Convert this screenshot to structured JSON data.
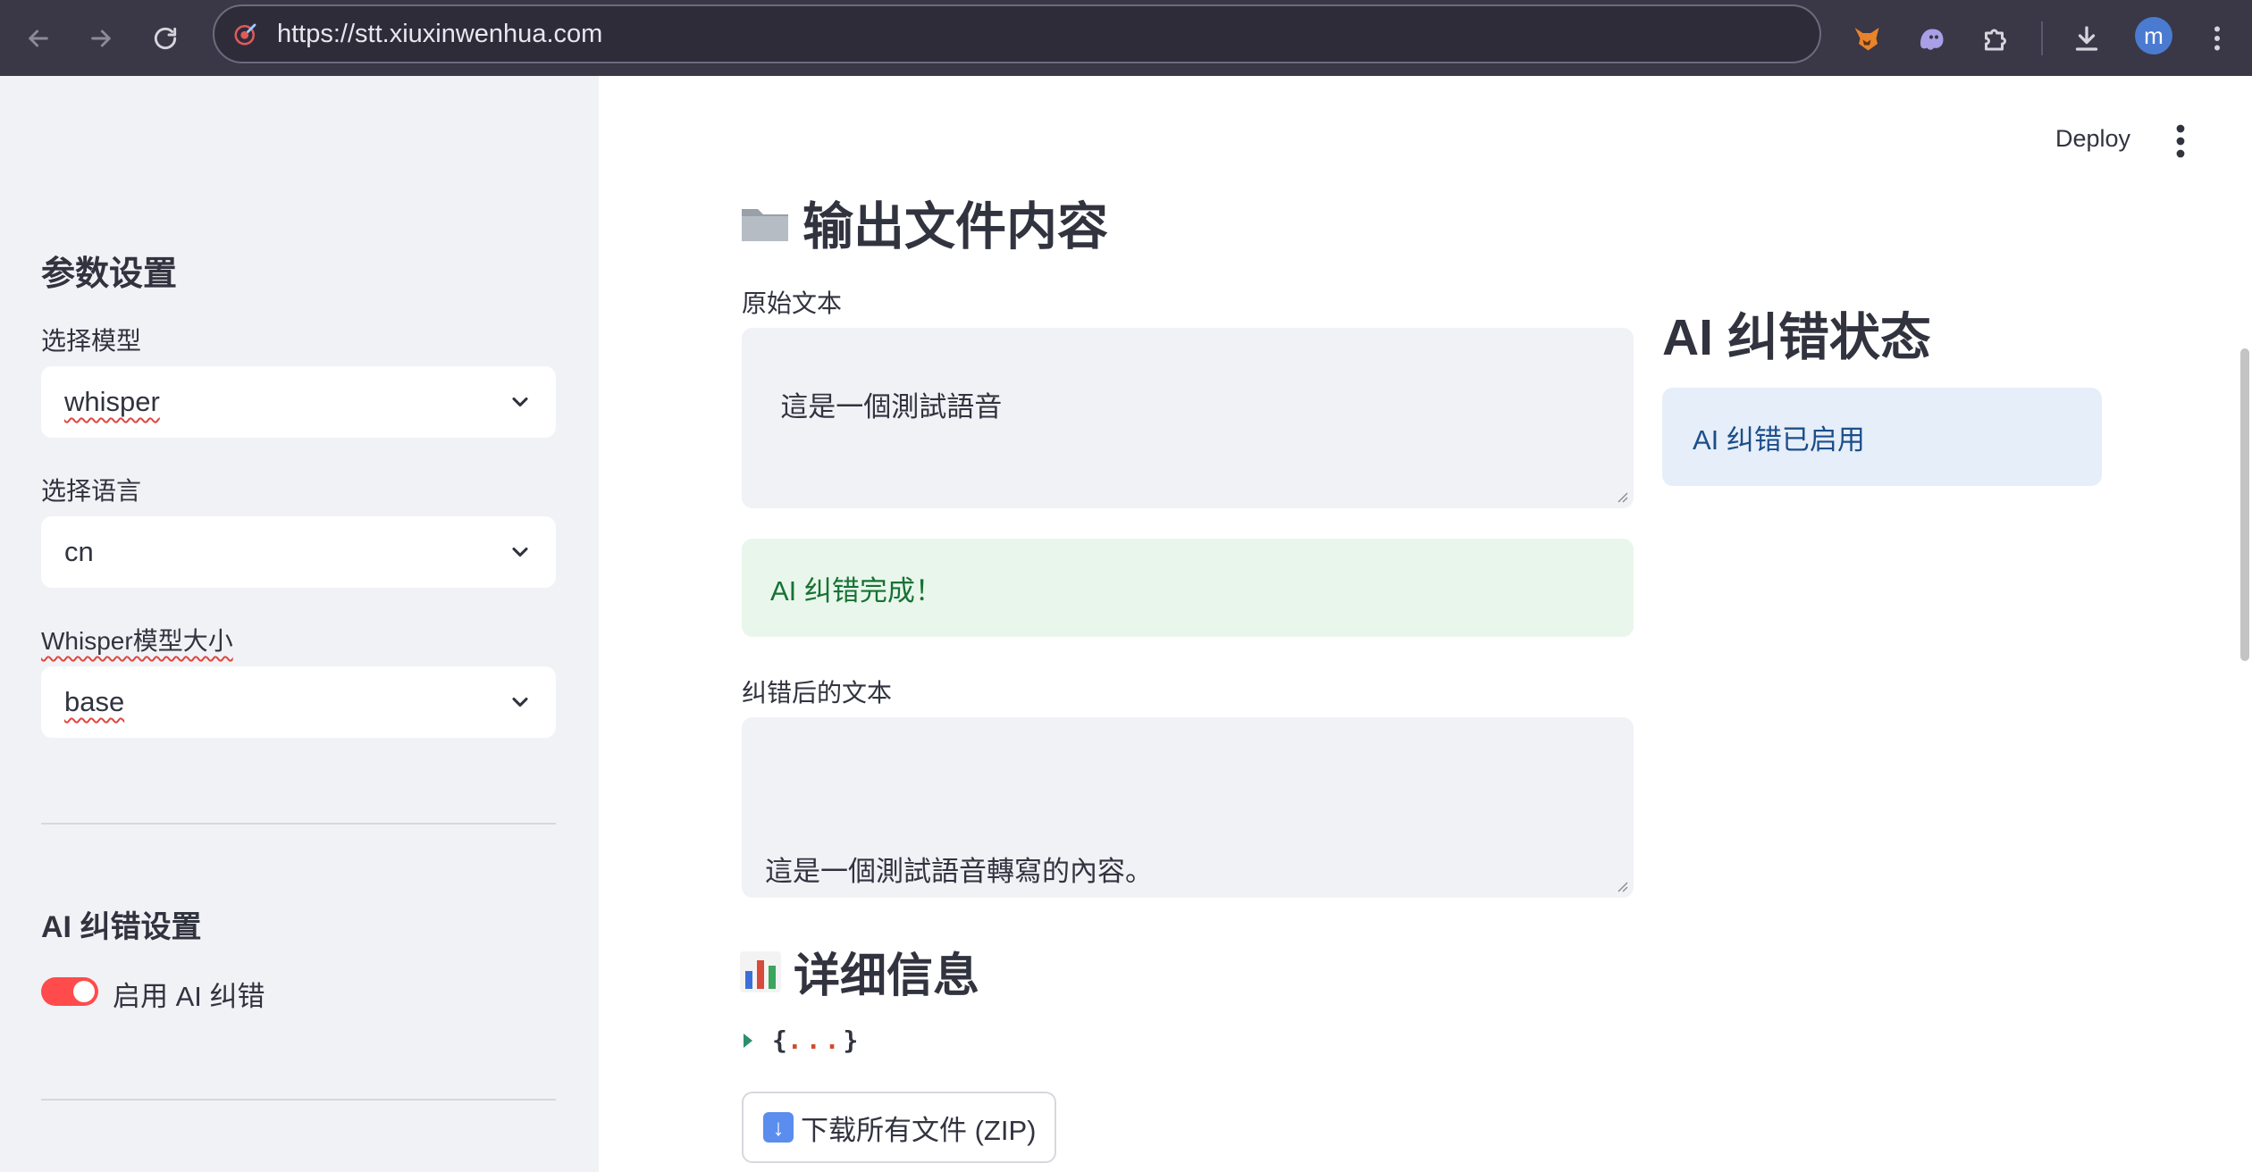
{
  "browser": {
    "url": "https://stt.xiuxinwenhua.com",
    "avatar_letter": "m"
  },
  "sidebar": {
    "title": "参数设置",
    "model_label": "选择模型",
    "model_value": "whisper",
    "language_label": "选择语言",
    "language_value": "cn",
    "size_label": "Whisper模型大小",
    "size_value": "base",
    "ai_title": "AI 纠错设置",
    "ai_toggle_label": "启用 AI 纠错",
    "ai_toggle_on": true
  },
  "header": {
    "deploy_label": "Deploy"
  },
  "main": {
    "output_title": "输出文件内容",
    "original_label": "原始文本",
    "original_text": "這是一個測試語音",
    "success_message": "AI 纠错完成！",
    "corrected_label": "纠错后的文本",
    "corrected_text": "\n\n這是一個測試語音轉寫的內容。",
    "details_title": "详细信息",
    "json_open": "{",
    "json_dots": "...",
    "json_close": "}",
    "download_label": "下载所有文件 (ZIP)"
  },
  "status_panel": {
    "title": "AI 纠错状态",
    "info_message": "AI 纠错已启用"
  },
  "colors": {
    "chrome_bg": "#3a3747",
    "sidebar_bg": "#f0f2f6",
    "toggle_on": "#ff4b4b",
    "success_bg": "#e9f6ec",
    "success_text": "#177233",
    "info_bg": "#e6eef9",
    "info_text": "#1c4e8a"
  }
}
